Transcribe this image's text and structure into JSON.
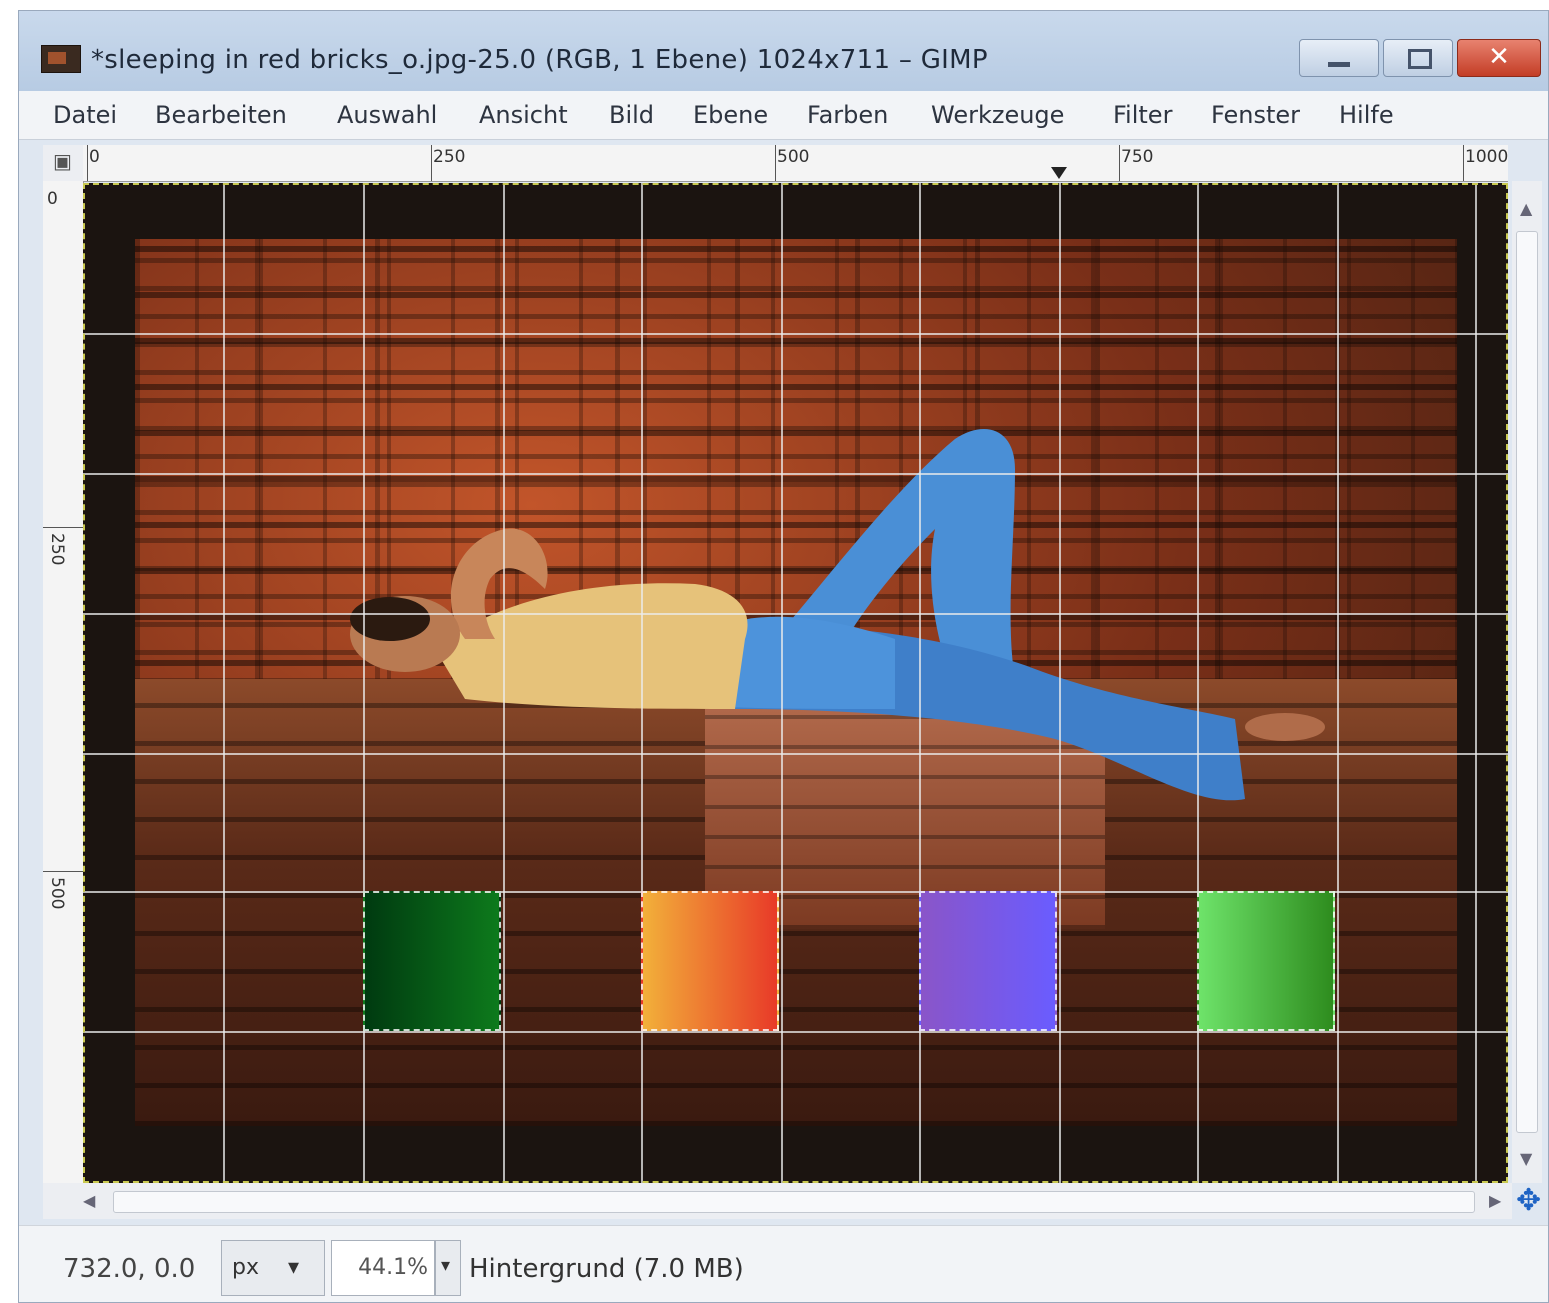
{
  "window": {
    "title": "*sleeping in red bricks_o.jpg-25.0 (RGB, 1 Ebene) 1024x711 – GIMP",
    "close_label": "✕"
  },
  "menubar": {
    "items": [
      "Datei",
      "Bearbeiten",
      "Auswahl",
      "Ansicht",
      "Bild",
      "Ebene",
      "Farben",
      "Werkzeuge",
      "Filter",
      "Fenster",
      "Hilfe"
    ]
  },
  "ruler": {
    "corner_icon": "▣",
    "top_labels": [
      "0",
      "250",
      "500",
      "750",
      "1000"
    ],
    "left_labels": [
      "0",
      "250",
      "500"
    ]
  },
  "image": {
    "swatches": [
      {
        "name": "dark-green",
        "from": "#003a10",
        "to": "#0d7a1c"
      },
      {
        "name": "orange-red",
        "from": "#f2b03a",
        "to": "#e83a28"
      },
      {
        "name": "purple-blue",
        "from": "#8a55c8",
        "to": "#6a5cff"
      },
      {
        "name": "light-green",
        "from": "#6ee36a",
        "to": "#2e8c1e"
      }
    ]
  },
  "statusbar": {
    "coords": "732.0, 0.0",
    "unit": "px",
    "zoom": "44.1%",
    "layer_info": "Hintergrund (7.0 MB)"
  },
  "icons": {
    "navigate": "navigate-icon",
    "dropdown": "▾"
  }
}
